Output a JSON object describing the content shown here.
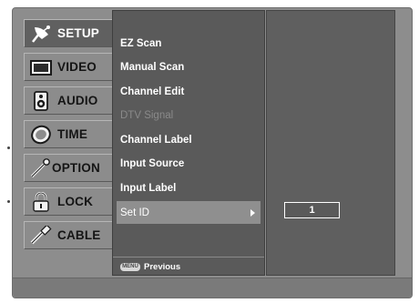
{
  "sidebar": {
    "items": [
      {
        "label": "SETUP",
        "icon": "satellite-dish-icon",
        "active": true
      },
      {
        "label": "VIDEO",
        "icon": "tv-screen-icon"
      },
      {
        "label": "AUDIO",
        "icon": "speaker-icon"
      },
      {
        "label": "TIME",
        "icon": "clock-icon"
      },
      {
        "label": "OPTION",
        "icon": "option-icon"
      },
      {
        "label": "LOCK",
        "icon": "padlock-icon"
      },
      {
        "label": "CABLE",
        "icon": "cable-icon"
      }
    ]
  },
  "submenu": {
    "items": [
      {
        "label": "EZ Scan"
      },
      {
        "label": "Manual Scan"
      },
      {
        "label": "Channel Edit"
      },
      {
        "label": "DTV Signal",
        "disabled": true
      },
      {
        "label": "Channel Label"
      },
      {
        "label": "Input Source"
      },
      {
        "label": "Input Label"
      },
      {
        "label": "Set ID",
        "selected": true
      }
    ],
    "footer": {
      "badge": "MENU",
      "label": "Previous"
    }
  },
  "set_id": {
    "value": "1"
  }
}
